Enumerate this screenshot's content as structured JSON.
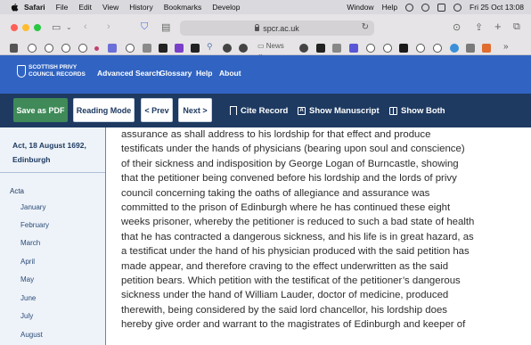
{
  "menubar": {
    "app": "Safari",
    "items": [
      "File",
      "Edit",
      "View",
      "History",
      "Bookmarks",
      "Develop"
    ],
    "window": "Window",
    "help": "Help",
    "clock": "Fri 25 Oct  13:08"
  },
  "browser": {
    "url": "spcr.ac.uk",
    "bookmarks_folder": "News"
  },
  "site": {
    "logo_line1": "SCOTTISH PRIVY",
    "logo_line2": "COUNCIL RECORDS",
    "nav": [
      "Advanced Search",
      "Glossary",
      "Help",
      "About"
    ]
  },
  "toolbar": {
    "save_pdf": "Save as PDF",
    "reading_mode": "Reading Mode",
    "prev": "< Prev",
    "next": "Next >",
    "cite": "Cite Record",
    "manuscript": "Show Manuscript",
    "both": "Show Both"
  },
  "sidebar": {
    "record_title": "Act, 18 August 1692, Edinburgh",
    "section": "Acta",
    "months": [
      "January",
      "February",
      "March",
      "April",
      "May",
      "June",
      "July",
      "August"
    ]
  },
  "record": {
    "lines": [
      "assurance as shall address to his lordship for that effect and produce",
      "testificats under the hands of physicians (bearing upon soul and conscience)",
      "of their sickness and indisposition by George Logan of Burncastle, showing",
      "that the petitioner being convened before his lordship and the lords of privy",
      "council concerning taking the oaths of allegiance and assurance was",
      "committed to the prison of Edinburgh where he has continued these eight",
      "weeks prisoner, whereby the petitioner is reduced to such a bad state of health",
      "that he has contracted a dangerous sickness, and his life is in great hazard, as",
      "a testificat under the hand of his physician produced with the said petition has",
      "made appear, and therefore craving to the effect underwritten as the said",
      "petition bears. Which petition with the testificat of the petitioner’s dangerous",
      "sickness under the hand of William Lauder, doctor of medicine, produced",
      "therewith, being considered by the said lord chancellor, his lordship does",
      "hereby give order and warrant to the magistrates of Edinburgh and keeper of"
    ]
  },
  "colors": {
    "site_header": "#3164c2",
    "record_toolbar": "#1e3a61",
    "save_button": "#3f8a58",
    "sidebar_bg": "#eef3f9"
  }
}
